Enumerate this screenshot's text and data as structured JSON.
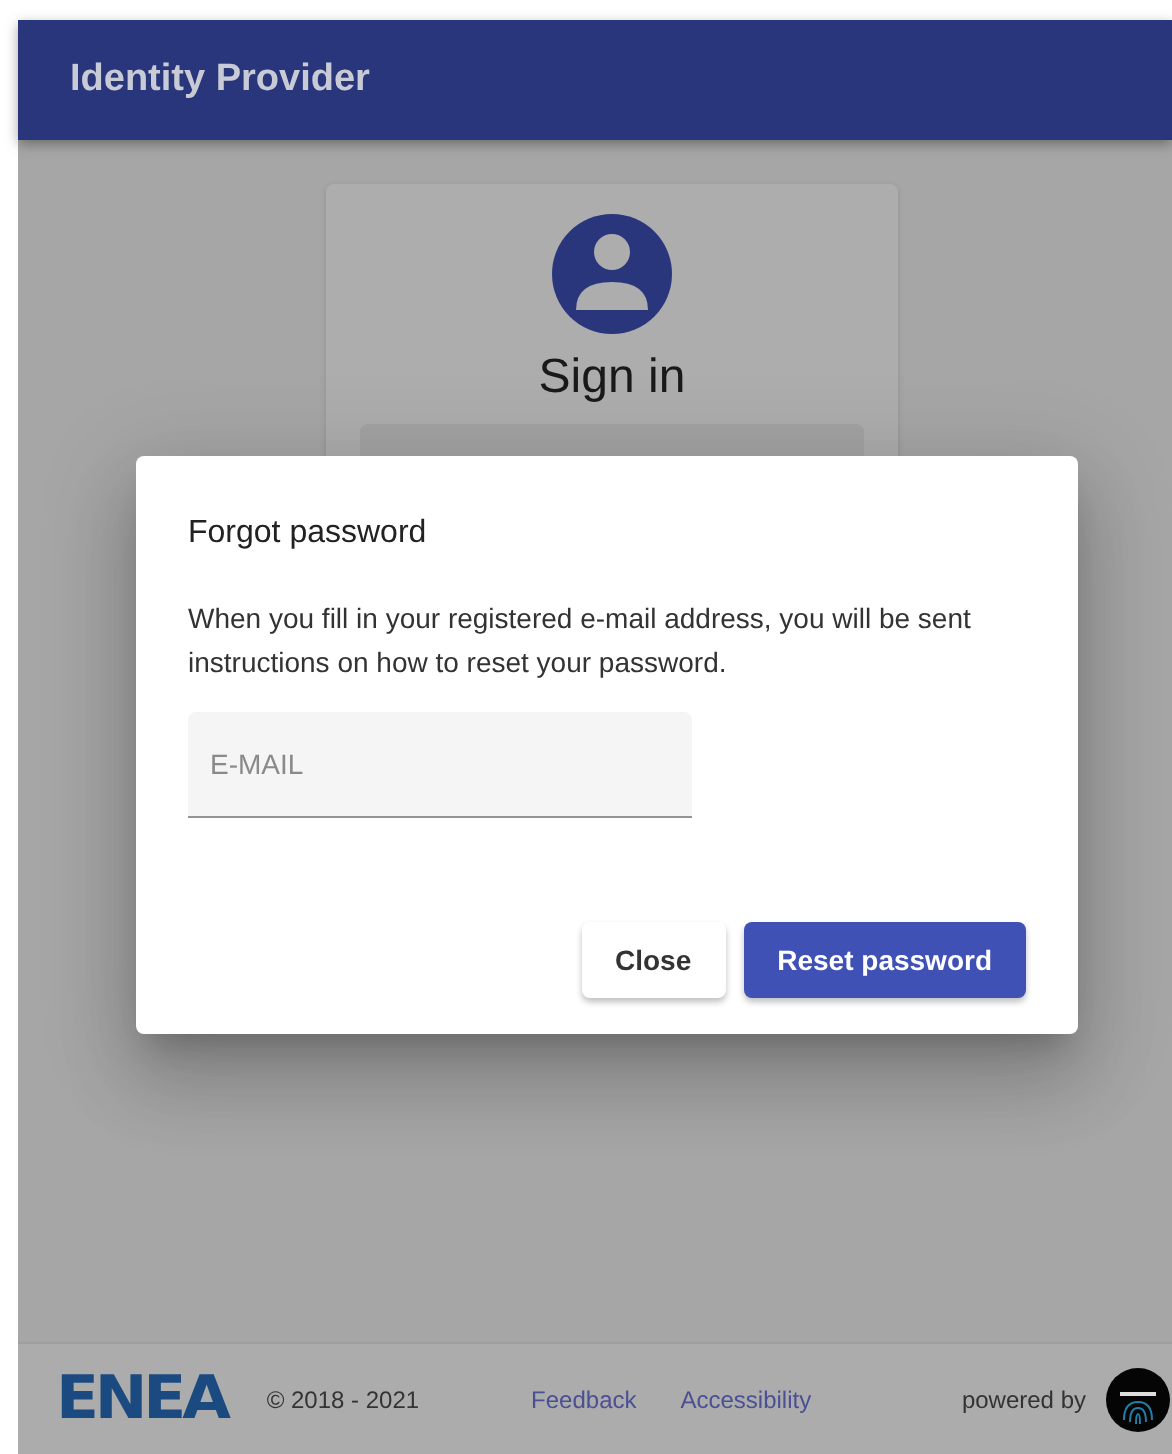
{
  "header": {
    "title": "Identity Provider"
  },
  "sign_in_card": {
    "title": "Sign in"
  },
  "dialog": {
    "title": "Forgot password",
    "message": "When you fill in your registered e-mail address, you will be sent instructions on how to reset your password.",
    "email_field": {
      "placeholder": "E-MAIL"
    },
    "buttons": [
      {
        "label": "Close",
        "kind": "secondary"
      },
      {
        "label": "Reset password",
        "kind": "primary"
      }
    ]
  },
  "footer": {
    "logo": "ENEA",
    "copyright": "© 2018 - 2021",
    "links": [
      "Feedback",
      "Accessibility"
    ],
    "powered_by": "powered by"
  }
}
